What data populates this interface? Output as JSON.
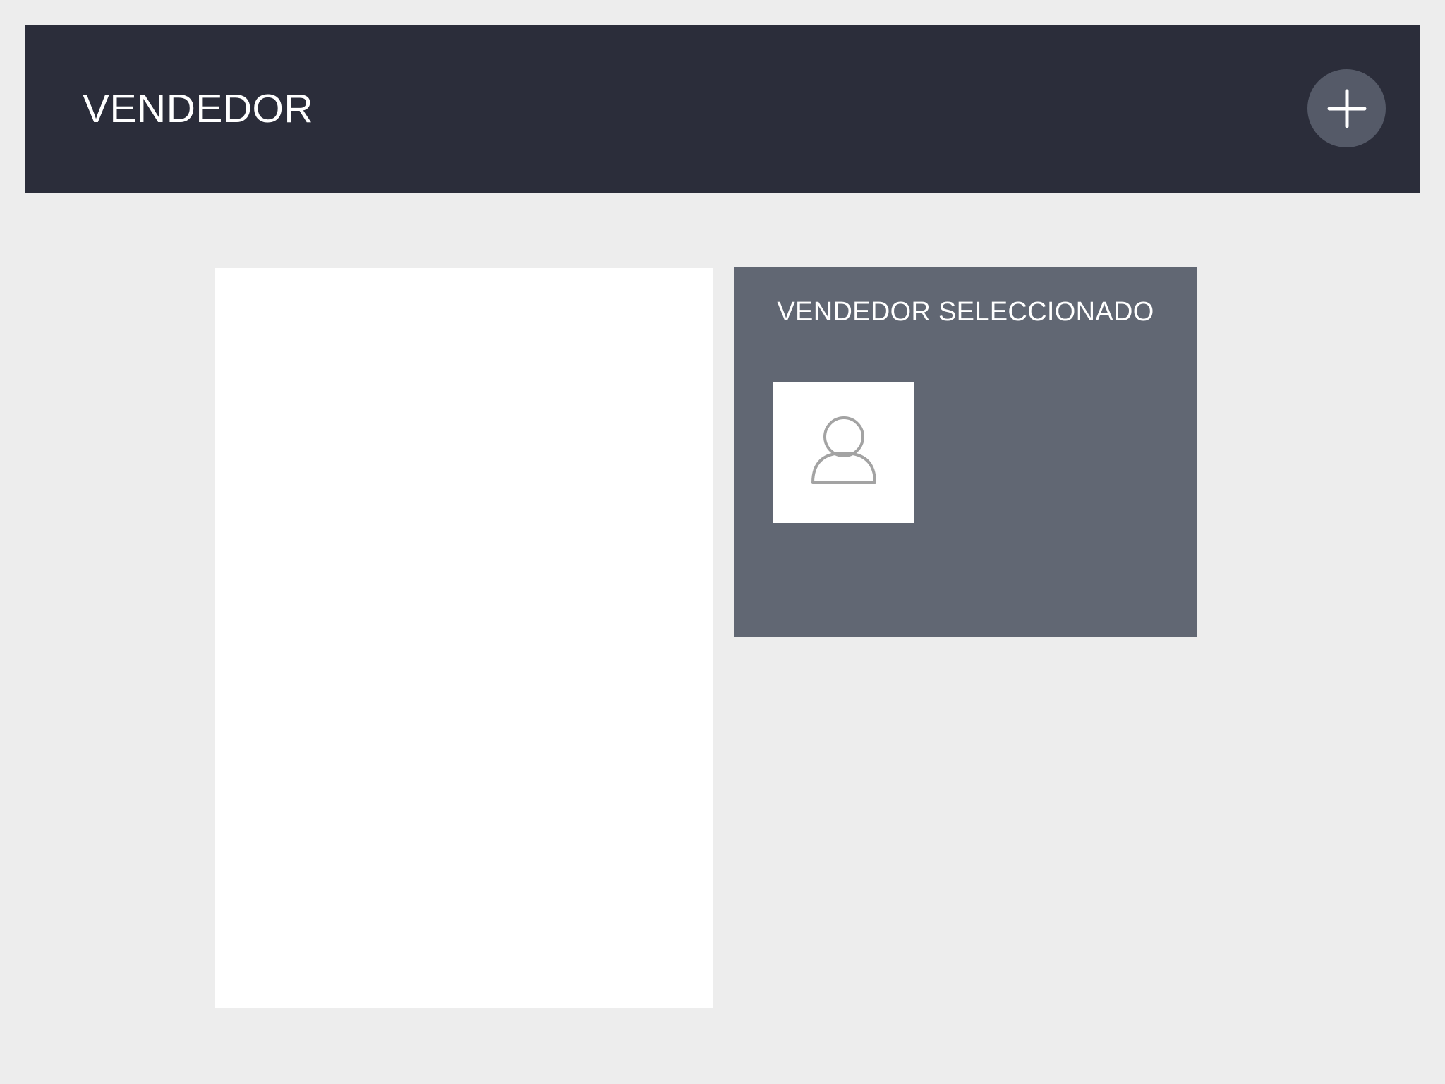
{
  "header": {
    "title": "VENDEDOR",
    "add_icon": "plus-icon"
  },
  "selected_panel": {
    "title": "VENDEDOR SELECCIONADO",
    "avatar_icon": "person-icon"
  },
  "colors": {
    "background": "#ededed",
    "header": "#2b2d3a",
    "add_button": "#555a68",
    "selected_panel": "#616773",
    "list_panel": "#ffffff",
    "avatar_stroke": "#a3a3a3"
  }
}
